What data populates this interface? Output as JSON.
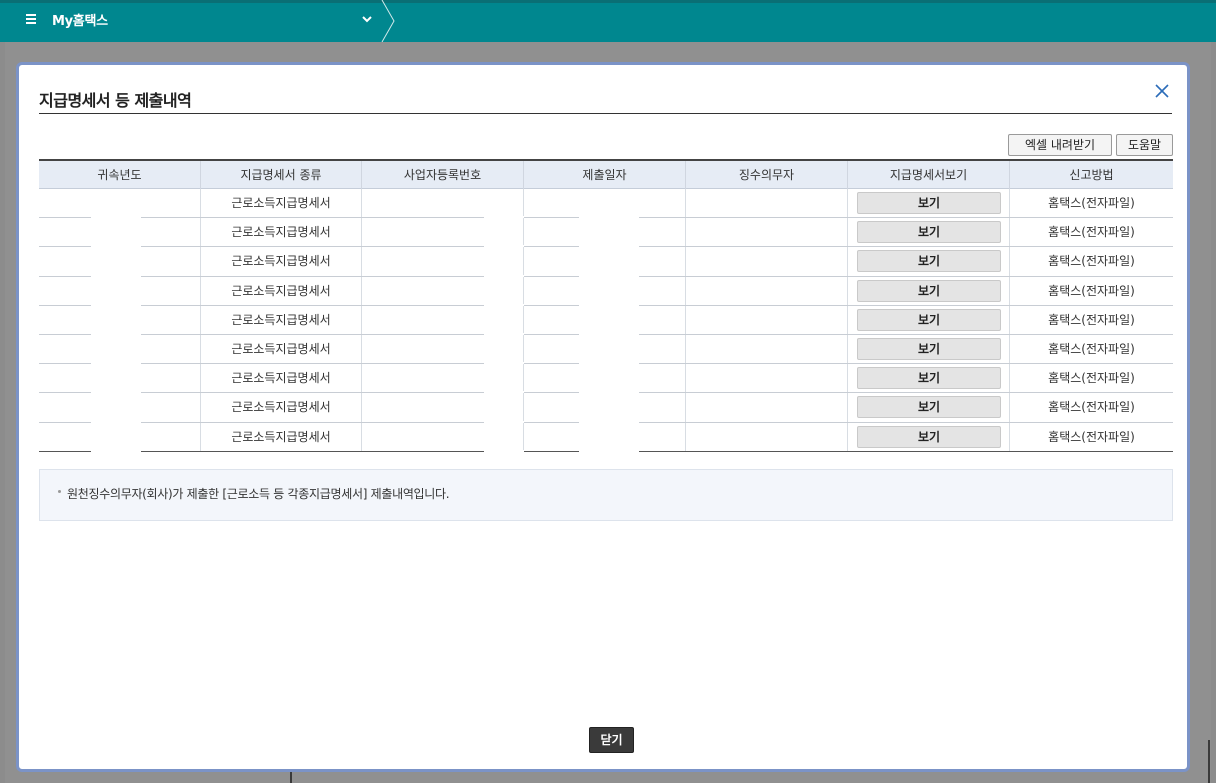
{
  "topbar": {
    "title": "My홈택스"
  },
  "modal": {
    "title": "지급명세서 등 제출내역",
    "buttons": {
      "excel": "엑셀 내려받기",
      "help": "도움말",
      "close": "닫기"
    },
    "table": {
      "headers": [
        "귀속년도",
        "지급명세서 종류",
        "사업자등록번호",
        "제출일자",
        "징수의무자",
        "지급명세서보기",
        "신고방법"
      ],
      "rows": [
        {
          "type": "근로소득지급명세서",
          "view": "보기",
          "method": "홈택스(전자파일)"
        },
        {
          "type": "근로소득지급명세서",
          "view": "보기",
          "method": "홈택스(전자파일)"
        },
        {
          "type": "근로소득지급명세서",
          "view": "보기",
          "method": "홈택스(전자파일)"
        },
        {
          "type": "근로소득지급명세서",
          "view": "보기",
          "method": "홈택스(전자파일)"
        },
        {
          "type": "근로소득지급명세서",
          "view": "보기",
          "method": "홈택스(전자파일)"
        },
        {
          "type": "근로소득지급명세서",
          "view": "보기",
          "method": "홈택스(전자파일)"
        },
        {
          "type": "근로소득지급명세서",
          "view": "보기",
          "method": "홈택스(전자파일)"
        },
        {
          "type": "근로소득지급명세서",
          "view": "보기",
          "method": "홈택스(전자파일)"
        },
        {
          "type": "근로소득지급명세서",
          "view": "보기",
          "method": "홈택스(전자파일)"
        }
      ]
    },
    "info": "원천징수의무자(회사)가 제출한 [근로소득 등 각종지급명세서] 제출내역입니다."
  },
  "colors": {
    "topbar": "#00878f",
    "header_bg": "#e6ecf5",
    "modal_border": "#7b93c7"
  }
}
